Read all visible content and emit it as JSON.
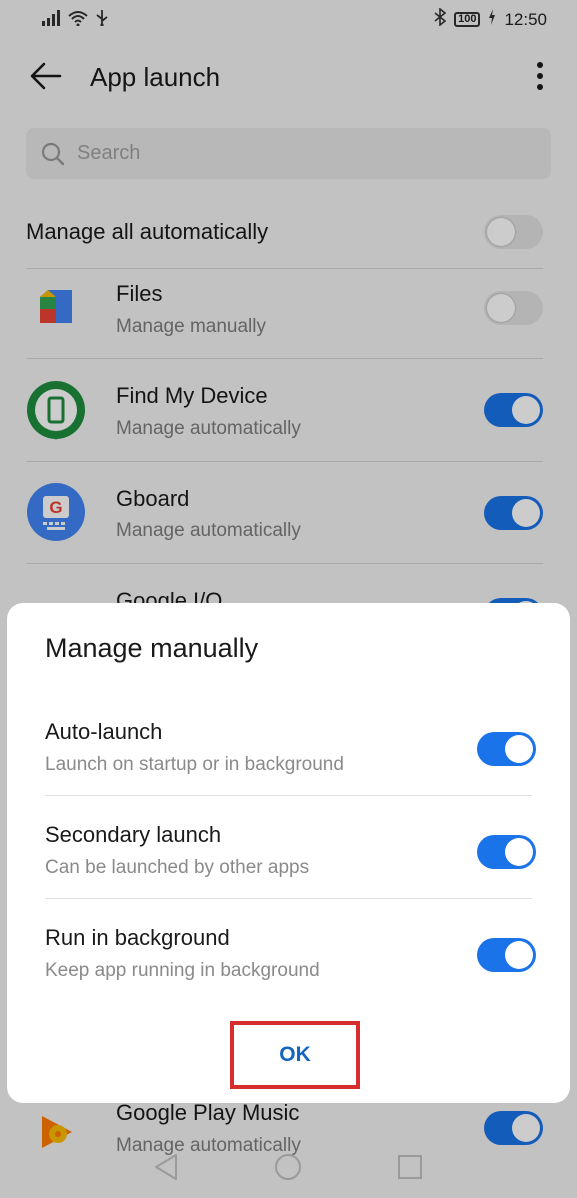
{
  "status_bar": {
    "time": "12:50",
    "battery": "100"
  },
  "header": {
    "title": "App launch"
  },
  "search": {
    "placeholder": "Search"
  },
  "manage_all": {
    "label": "Manage all automatically",
    "enabled": false
  },
  "apps": [
    {
      "name": "Files",
      "status": "Manage manually",
      "enabled": false
    },
    {
      "name": "Find My Device",
      "status": "Manage automatically",
      "enabled": true
    },
    {
      "name": "Gboard",
      "status": "Manage automatically",
      "enabled": true
    },
    {
      "name": "Google I/O",
      "status": "",
      "enabled": true
    },
    {
      "name": "Google Play Music",
      "status": "Manage automatically",
      "enabled": true
    }
  ],
  "dialog": {
    "title": "Manage manually",
    "options": [
      {
        "label": "Auto-launch",
        "description": "Launch on startup or in background",
        "enabled": true
      },
      {
        "label": "Secondary launch",
        "description": "Can be launched by other apps",
        "enabled": true
      },
      {
        "label": "Run in background",
        "description": "Keep app running in background",
        "enabled": true
      }
    ],
    "ok_label": "OK"
  },
  "colors": {
    "accent": "#1a73e8",
    "ok_text": "#1565c0",
    "highlight": "#d62d2d"
  },
  "icons": [
    "signal-icon",
    "wifi-icon",
    "usb-icon",
    "bluetooth-icon",
    "battery-icon",
    "charging-icon",
    "back-arrow-icon",
    "more-vert-icon",
    "search-icon",
    "files-icon",
    "find-my-device-icon",
    "gboard-icon",
    "google-io-icon",
    "play-music-icon",
    "nav-back-icon",
    "nav-home-icon",
    "nav-recents-icon"
  ]
}
